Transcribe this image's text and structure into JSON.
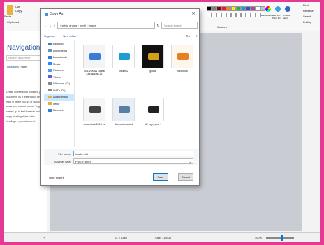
{
  "ribbon": {
    "left_labels": [
      "Cut",
      "Copy",
      "Paste",
      "Clipboard"
    ],
    "right_labels": [
      "Edit colours",
      "Edit with Paint 3D",
      "Product alert"
    ],
    "right_panel": [
      "Find",
      "Replace",
      "Select",
      "Editing"
    ],
    "colours_label": "Colours",
    "palette": [
      "#000000",
      "#7f7f7f",
      "#880015",
      "#ed1c24",
      "#ff7f27",
      "#fff200",
      "#22b14c",
      "#00a2e8",
      "#3f48cc",
      "#a349a4",
      "#ffffff",
      "#c3c3c3"
    ]
  },
  "navigation": {
    "title": "Navigation",
    "search_placeholder": "Search document",
    "tabs": [
      "Headings",
      "Pages"
    ],
    "text": "Create an interactive outline of your document. It's a great way to keep track of where you are or quickly move your content around. To get started, go to the Home tab and apply Heading styles to the headings in your document."
  },
  "dialog": {
    "title": "Save As",
    "path": "› tahija anuag › mbyji › image",
    "search_placeholder": "Search image",
    "organise": "Organise ▾",
    "new_folder": "New folder",
    "tree": [
      {
        "label": "Desktop",
        "color": "#3a7bd5"
      },
      {
        "label": "Documents",
        "color": "#6b8fb5"
      },
      {
        "label": "Downloads",
        "color": "#3a7bd5"
      },
      {
        "label": "Music",
        "color": "#1e90ff"
      },
      {
        "label": "Pictures",
        "color": "#4aa3df"
      },
      {
        "label": "Videos",
        "color": "#6a5acd"
      },
      {
        "label": "Windows (C:)",
        "color": "#888888"
      },
      {
        "label": "DATA (D:)",
        "color": "#888888"
      },
      {
        "label": "Addnminitud",
        "color": "#e0b040"
      },
      {
        "label": "office",
        "color": "#e0b040"
      },
      {
        "label": "Network",
        "color": "#3a7bd5"
      }
    ],
    "files": [
      {
        "name": "KELASKAN Digital Kecakapan 21",
        "bg": "#f2f4f7",
        "accent": "#3a7bd5"
      },
      {
        "name": "Indaw02",
        "bg": "#ffffff",
        "accent": "#1f9bd6"
      },
      {
        "name": "global",
        "bg": "#111111",
        "accent": "#d4a017"
      },
      {
        "name": "indonesia",
        "bg": "#fdf6ec",
        "accent": "#e67e22"
      },
      {
        "name": "cowarntalk 2014 ks",
        "bg": "#f5f5f5",
        "accent": "#444444"
      },
      {
        "name": "diarequiresarted",
        "bg": "#e9eef5",
        "accent": "#5a7fa6"
      },
      {
        "name": "UK logo_shot 1",
        "bg": "#ffffff",
        "accent": "#222222"
      }
    ],
    "filename_label": "File name:",
    "filename_value": "hasilo edit",
    "type_label": "Save as type:",
    "type_value": "PNG (*.png)",
    "hide_folders": "Hide folders",
    "save": "Save",
    "cancel": "Cancel"
  },
  "status": {
    "left": "+",
    "dims": "61 × 18px",
    "size": "Size: 11.6KB",
    "zoom": "100%"
  }
}
